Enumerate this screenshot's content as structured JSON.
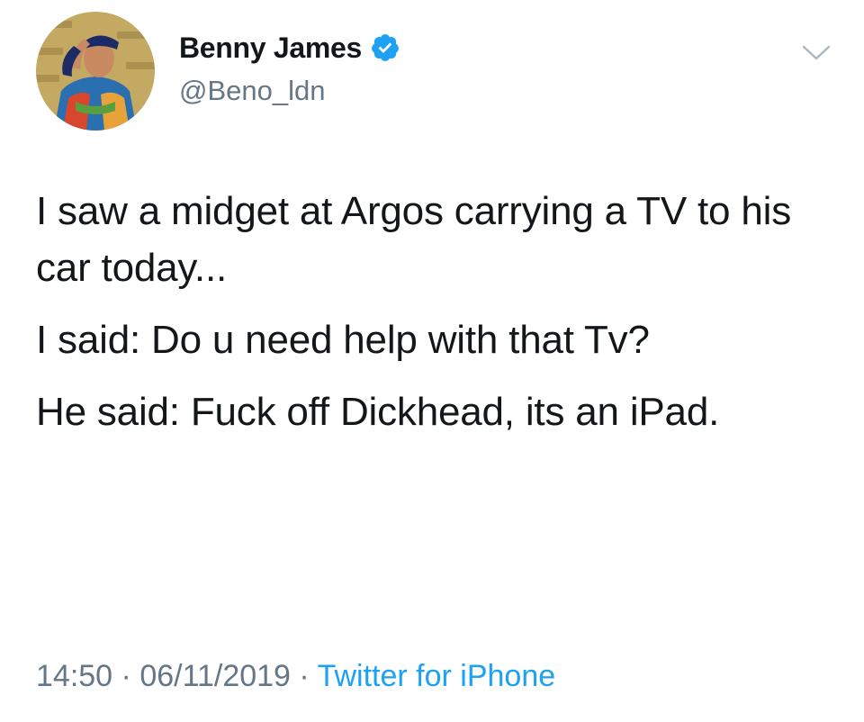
{
  "tweet": {
    "author": {
      "display_name": "Benny James",
      "handle": "@Beno_ldn",
      "verified": true
    },
    "paragraphs": [
      "I saw a midget at Argos carrying a TV to his car today...",
      "I said: Do u need help with that Tv?",
      "He said: Fuck off Dickhead, its an iPad."
    ],
    "time": "14:50",
    "separator": " · ",
    "date": "06/11/2019",
    "source": "Twitter for iPhone"
  },
  "colors": {
    "text_primary": "#14171a",
    "text_secondary": "#657786",
    "accent_blue": "#1da1f2"
  },
  "icons": {
    "verified": "verified-badge-icon",
    "menu": "chevron-down-icon"
  }
}
